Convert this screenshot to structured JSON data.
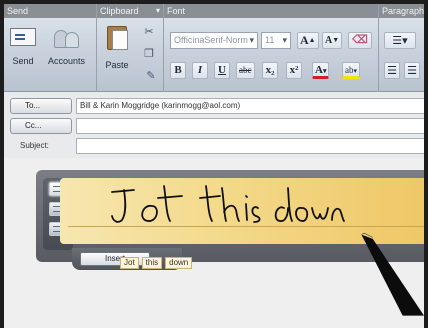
{
  "ribbon": {
    "groups": {
      "send": "Send",
      "clipboard": "Clipboard",
      "font": "Font",
      "paragraph": "Paragraph"
    },
    "buttons": {
      "send": "Send",
      "accounts": "Accounts",
      "paste": "Paste"
    },
    "font_name": "OfficinaSerif-Norm",
    "font_size": "11",
    "format_buttons": {
      "grow": "A",
      "shrink": "A",
      "bold": "B",
      "italic": "I",
      "underline": "U",
      "strike": "abc",
      "subscript": "x₂",
      "superscript": "x²",
      "font_color": "A",
      "highlight": "ab"
    }
  },
  "fields": {
    "to_label": "To...",
    "to_value": "Bill & Karin Moggridge (karinmogg@aol.com)",
    "cc_label": "Cc...",
    "cc_value": "",
    "subject_label": "Subject:",
    "subject_value": ""
  },
  "input_panel": {
    "candidates": [
      "Jot",
      "this",
      "down"
    ],
    "insert_label": "Insert"
  },
  "colors": {
    "pad_start": "#f6e7b0",
    "pad_end": "#efc766",
    "ribbon_header": "#8a8f96"
  }
}
